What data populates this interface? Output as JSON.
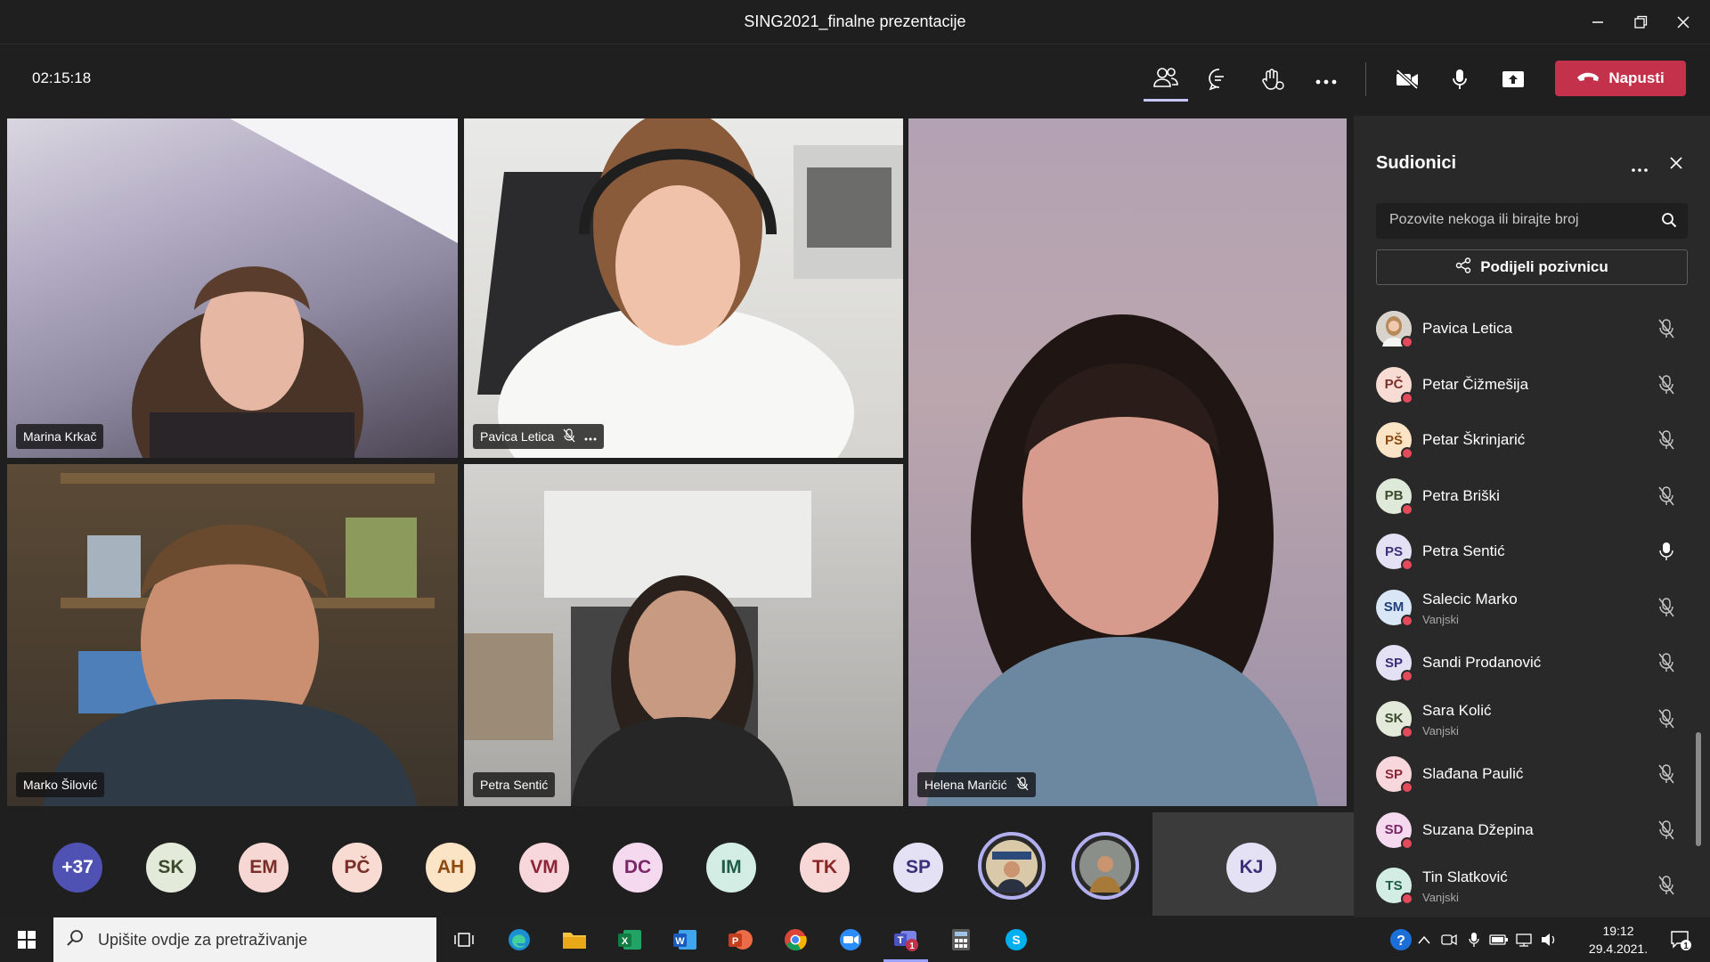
{
  "window": {
    "title": "SING2021_finalne prezentacije"
  },
  "toolbar": {
    "timer": "02:15:18",
    "leave_label": "Napusti"
  },
  "video_tiles": [
    {
      "name": "Marina Krkač"
    },
    {
      "name": "Pavica Letica"
    },
    {
      "name": "Helena Maričić"
    },
    {
      "name": "Marko Šilović"
    },
    {
      "name": "Petra Sentić"
    }
  ],
  "strip": [
    {
      "initials": "+37"
    },
    {
      "initials": "SK"
    },
    {
      "initials": "EM"
    },
    {
      "initials": "PČ"
    },
    {
      "initials": "AH"
    },
    {
      "initials": "VM"
    },
    {
      "initials": "DC"
    },
    {
      "initials": "IM"
    },
    {
      "initials": "TK"
    },
    {
      "initials": "SP"
    },
    {
      "initials": "KJ"
    }
  ],
  "panel": {
    "title": "Sudionici",
    "search_placeholder": "Pozovite nekoga ili birajte broj",
    "share_label": "Podijeli pozivnicu",
    "participants": [
      {
        "name": "Pavica Letica",
        "initials": "",
        "sub": "",
        "mic": "muted"
      },
      {
        "name": "Petar Čižmešija",
        "initials": "PČ",
        "sub": "",
        "mic": "muted"
      },
      {
        "name": "Petar Škrinjarić",
        "initials": "PŠ",
        "sub": "",
        "mic": "muted"
      },
      {
        "name": "Petra Briški",
        "initials": "PB",
        "sub": "",
        "mic": "muted"
      },
      {
        "name": "Petra Sentić",
        "initials": "PS",
        "sub": "",
        "mic": "on"
      },
      {
        "name": "Salecic Marko",
        "initials": "SM",
        "sub": "Vanjski",
        "mic": "muted"
      },
      {
        "name": "Sandi Prodanović",
        "initials": "SP",
        "sub": "",
        "mic": "muted"
      },
      {
        "name": "Sara Kolić",
        "initials": "SK",
        "sub": "Vanjski",
        "mic": "muted"
      },
      {
        "name": "Slađana Paulić",
        "initials": "SP",
        "sub": "",
        "mic": "muted"
      },
      {
        "name": "Suzana Džepina",
        "initials": "SD",
        "sub": "",
        "mic": "muted"
      },
      {
        "name": "Tin Slatković",
        "initials": "TS",
        "sub": "Vanjski",
        "mic": "muted"
      }
    ]
  },
  "taskbar": {
    "search_placeholder": "Upišite ovdje za pretraživanje",
    "time": "19:12",
    "date": "29.4.2021.",
    "notification_count": "1"
  }
}
